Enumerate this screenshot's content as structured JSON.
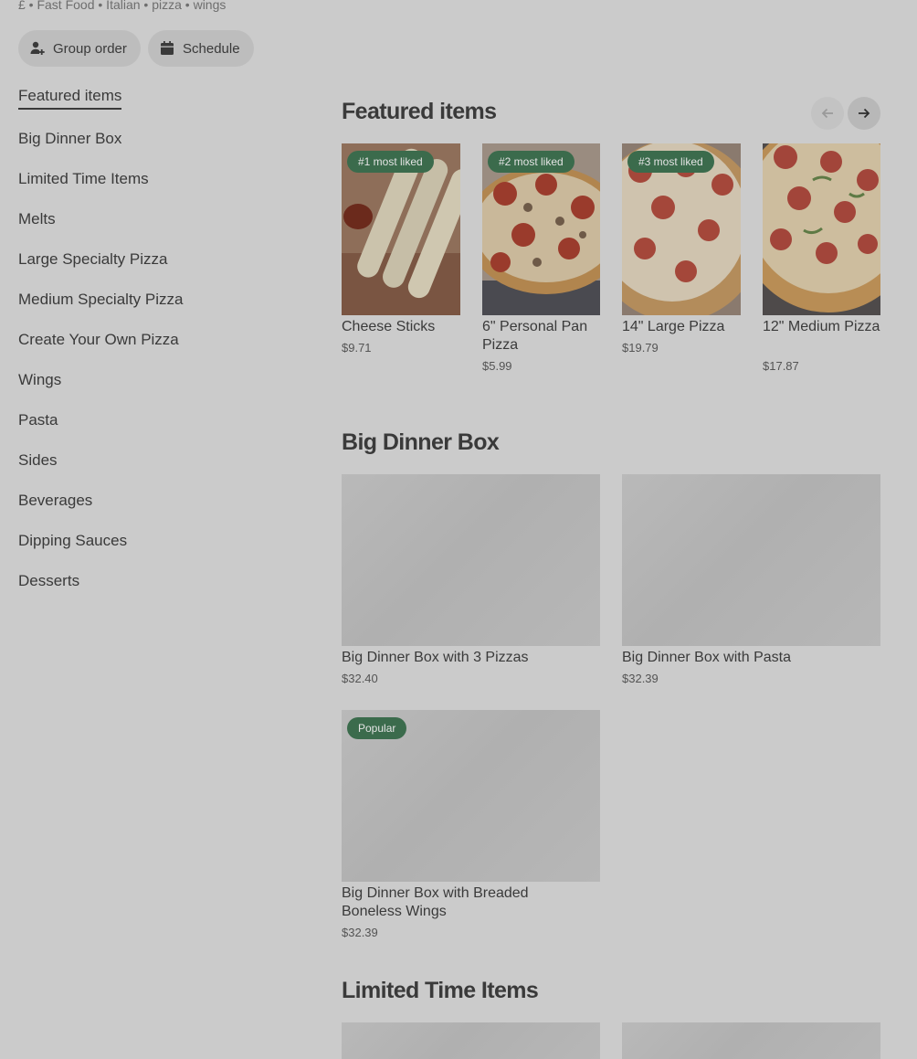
{
  "header": {
    "meta_line": "£ • Fast Food • Italian • pizza • wings",
    "group_order_label": "Group order",
    "schedule_label": "Schedule"
  },
  "sidebar": {
    "items": [
      {
        "label": "Featured items",
        "active": true
      },
      {
        "label": "Big Dinner Box"
      },
      {
        "label": "Limited Time Items"
      },
      {
        "label": "Melts"
      },
      {
        "label": "Large Specialty Pizza"
      },
      {
        "label": "Medium Specialty Pizza"
      },
      {
        "label": "Create Your Own Pizza"
      },
      {
        "label": "Wings"
      },
      {
        "label": "Pasta"
      },
      {
        "label": "Sides"
      },
      {
        "label": "Beverages"
      },
      {
        "label": "Dipping Sauces"
      },
      {
        "label": "Desserts"
      }
    ]
  },
  "featured": {
    "title": "Featured items",
    "items": [
      {
        "badge": "#1 most liked",
        "name": "Cheese Sticks",
        "price": "$9.71"
      },
      {
        "badge": "#2 most liked",
        "name": "6\" Personal Pan Pizza",
        "price": "$5.99"
      },
      {
        "badge": "#3 most liked",
        "name": "14\" Large Pizza",
        "price": "$19.79"
      },
      {
        "name": "12\" Medium Pizza",
        "price": "$17.87"
      }
    ]
  },
  "big_dinner_box": {
    "title": "Big Dinner Box",
    "items": [
      {
        "name": "Big Dinner Box with 3 Pizzas",
        "price": "$32.40"
      },
      {
        "name": "Big Dinner Box with Pasta",
        "price": "$32.39"
      },
      {
        "badge": "Popular",
        "name": "Big Dinner Box with Breaded Boneless Wings",
        "price": "$32.39"
      }
    ]
  },
  "limited_time": {
    "title": "Limited Time Items"
  },
  "colors": {
    "badge_green": "#3b6b4c",
    "overlay_gray": "#cbcbcb"
  }
}
